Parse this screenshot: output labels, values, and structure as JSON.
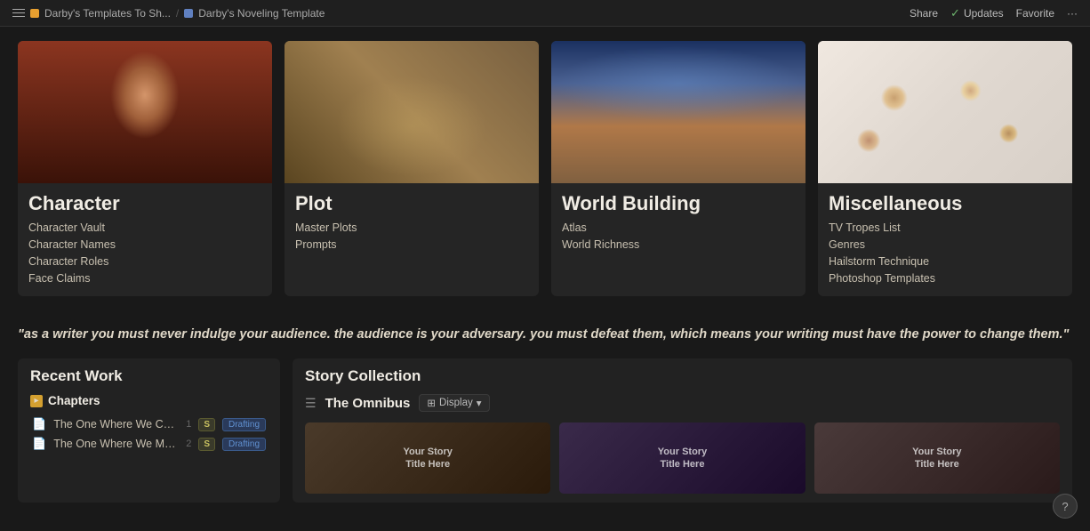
{
  "topbar": {
    "breadcrumb1": "Darby's Templates To Sh...",
    "breadcrumb2": "Darby's Noveling Template",
    "share_label": "Share",
    "updates_label": "Updates",
    "favorite_label": "Favorite"
  },
  "categories": [
    {
      "id": "character",
      "title": "Character",
      "image_class": "img-character",
      "links": [
        "Character Vault",
        "Character Names",
        "Character Roles",
        "Face Claims"
      ]
    },
    {
      "id": "plot",
      "title": "Plot",
      "image_class": "img-plot",
      "links": [
        "Master Plots",
        "Prompts"
      ]
    },
    {
      "id": "world",
      "title": "World Building",
      "image_class": "img-world",
      "links": [
        "Atlas",
        "World Richness"
      ]
    },
    {
      "id": "misc",
      "title": "Miscellaneous",
      "image_class": "img-misc",
      "links": [
        "TV Tropes List",
        "Genres",
        "Hailstorm Technique",
        "Photoshop Templates"
      ]
    }
  ],
  "quote": "\"as a writer you must never indulge your audience. the audience is your adversary. you must defeat them, which means your writing must have the power to change them.\"",
  "recent_work": {
    "title": "Recent Work",
    "chapters_label": "Chapters",
    "items": [
      {
        "name": "The One Where We Check Tha...",
        "num": "1",
        "badge_s": "S",
        "badge_status": "Drafting"
      },
      {
        "name": "The One Where We Make Sure...",
        "num": "2",
        "badge_s": "S",
        "badge_status": "Drafting"
      }
    ]
  },
  "story_collection": {
    "title": "Story Collection",
    "omnibus_label": "The Omnibus",
    "display_label": "Display",
    "thumbnails": [
      {
        "line1": "Your Story",
        "line2": "Title Here"
      },
      {
        "line1": "Your Story",
        "line2": "Title Here"
      },
      {
        "line1": "Your Story",
        "line2": "Title Here"
      }
    ]
  },
  "help": "?"
}
